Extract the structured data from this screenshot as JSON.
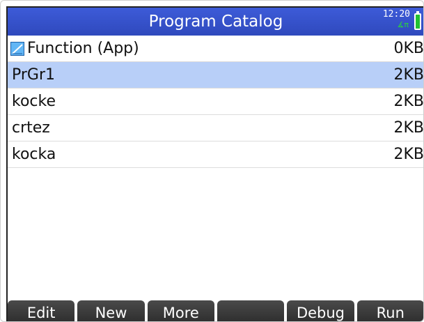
{
  "header": {
    "title": "Program Catalog",
    "clock": "12:20",
    "angle_mode": "∡π",
    "icons": [
      "battery-icon"
    ]
  },
  "colors": {
    "titlebar": "#3350cc",
    "selection": "#b8cff8",
    "softkey": "#333333",
    "battery": "#22c131"
  },
  "programs": [
    {
      "name": "Function (App)",
      "size": "0KB",
      "icon": "function-app-icon",
      "selected": false
    },
    {
      "name": "PrGr1",
      "size": "2KB",
      "selected": true
    },
    {
      "name": "kocke",
      "size": "2KB",
      "selected": false
    },
    {
      "name": "crtez",
      "size": "2KB",
      "selected": false
    },
    {
      "name": "kocka",
      "size": "2KB",
      "selected": false
    }
  ],
  "softkeys": [
    "Edit",
    "New",
    "More",
    "",
    "Debug",
    "Run"
  ]
}
